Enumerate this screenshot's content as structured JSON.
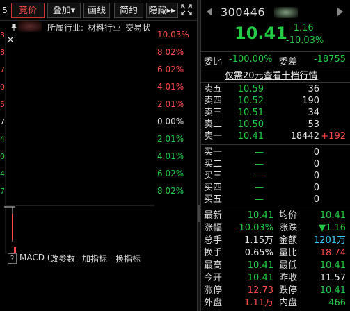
{
  "toolbar": {
    "edge_label": "5",
    "tabs": [
      "竞价",
      "叠加▾",
      "画线",
      "简约",
      "隐藏▸▸"
    ]
  },
  "industry": {
    "label": "所属行业:",
    "value": "材料行业",
    "status": "交易状"
  },
  "chart": {
    "pct_labels": [
      "10.03%",
      "8.02%",
      "6.02%",
      "4.01%",
      "2.01%",
      "0.00%",
      "2.01%",
      "4.01%",
      "6.02%",
      "8.02%"
    ],
    "left_edge_numbers": [
      "3",
      "8",
      "7",
      "0",
      "5",
      "7",
      "4",
      "0",
      "4",
      "7"
    ]
  },
  "indicators": {
    "help": "?",
    "macd": "MACD (",
    "change_params": "改参数",
    "add_indicator": "加指标",
    "switch_indicator": "换指标"
  },
  "quote": {
    "code": "300446",
    "price": "10.41",
    "change": "-1.16",
    "change_pct": "-10.03%",
    "weibi_label": "委比",
    "weibi_value": "-100.00%",
    "weicha_label": "委差",
    "weicha_value": "-18755",
    "upgrade_link": "仅需20元查看十档行情",
    "asks": [
      {
        "label": "卖五",
        "price": "10.59",
        "volume": "36"
      },
      {
        "label": "卖四",
        "price": "10.52",
        "volume": "190"
      },
      {
        "label": "卖三",
        "price": "10.51",
        "volume": "34"
      },
      {
        "label": "卖二",
        "price": "10.50",
        "volume": "53"
      },
      {
        "label": "卖一",
        "price": "10.41",
        "volume": "18442",
        "delta": "+192"
      }
    ],
    "bids": [
      {
        "label": "买一",
        "price": "—",
        "volume": "0"
      },
      {
        "label": "买二",
        "price": "—",
        "volume": "0"
      },
      {
        "label": "买三",
        "price": "—",
        "volume": "0"
      },
      {
        "label": "买四",
        "price": "—",
        "volume": "0"
      },
      {
        "label": "买五",
        "price": "—",
        "volume": "0"
      }
    ],
    "stats": [
      {
        "k1": "最新",
        "v1": "10.41",
        "c1": "g",
        "k2": "均价",
        "v2": "10.41",
        "c2": "g"
      },
      {
        "k1": "涨幅",
        "v1": "-10.03%",
        "c1": "g",
        "k2": "涨跌",
        "v2": "▼1.16",
        "c2": "g"
      },
      {
        "k1": "总手",
        "v1": "1.15万",
        "c1": "w",
        "k2": "金额",
        "v2": "1201万",
        "c2": "c"
      },
      {
        "k1": "换手",
        "v1": "0.65%",
        "c1": "w",
        "k2": "量比",
        "v2": "18.74",
        "c2": "r"
      },
      {
        "k1": "最高",
        "v1": "10.41",
        "c1": "g",
        "k2": "最低",
        "v2": "10.41",
        "c2": "g"
      },
      {
        "k1": "今开",
        "v1": "10.41",
        "c1": "g",
        "k2": "昨收",
        "v2": "11.57",
        "c2": "w"
      },
      {
        "k1": "涨停",
        "v1": "12.73",
        "c1": "r",
        "k2": "跌停",
        "v2": "10.41",
        "c2": "g"
      },
      {
        "k1": "外盘",
        "v1": "1.11万",
        "c1": "r",
        "k2": "内盘",
        "v2": "466",
        "c2": "g"
      }
    ]
  },
  "colors": {
    "up": "#ff4a4a",
    "down": "#22cc44",
    "neutral": "#dcdcdc",
    "amount": "#33ccff"
  },
  "icons": {
    "expand": "expand-icon",
    "prev": "triangle-left-icon",
    "next": "triangle-right-icon",
    "pin": "pin-icon",
    "close": "close-icon"
  }
}
